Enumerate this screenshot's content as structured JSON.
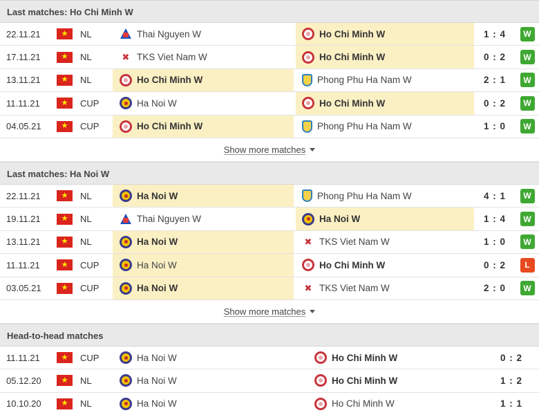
{
  "sections": [
    {
      "title": "Last matches: Ho Chi Minh W",
      "rows": [
        {
          "date": "22.11.21",
          "comp": "NL",
          "home": "Thai Nguyen W",
          "home_logo": "tn",
          "home_bold": false,
          "home_hl": false,
          "away": "Ho Chi Minh W",
          "away_logo": "hcm",
          "away_bold": true,
          "away_hl": true,
          "score": "1 : 4",
          "result": "W"
        },
        {
          "date": "17.11.21",
          "comp": "NL",
          "home": "TKS Viet Nam W",
          "home_logo": "tks",
          "home_bold": false,
          "home_hl": false,
          "away": "Ho Chi Minh W",
          "away_logo": "hcm",
          "away_bold": true,
          "away_hl": true,
          "score": "0 : 2",
          "result": "W"
        },
        {
          "date": "13.11.21",
          "comp": "NL",
          "home": "Ho Chi Minh W",
          "home_logo": "hcm",
          "home_bold": true,
          "home_hl": true,
          "away": "Phong Phu Ha Nam W",
          "away_logo": "pp",
          "away_bold": false,
          "away_hl": false,
          "score": "2 : 1",
          "result": "W"
        },
        {
          "date": "11.11.21",
          "comp": "CUP",
          "home": "Ha Noi W",
          "home_logo": "hanoi",
          "home_bold": false,
          "home_hl": false,
          "away": "Ho Chi Minh W",
          "away_logo": "hcm",
          "away_bold": true,
          "away_hl": true,
          "score": "0 : 2",
          "result": "W"
        },
        {
          "date": "04.05.21",
          "comp": "CUP",
          "home": "Ho Chi Minh W",
          "home_logo": "hcm",
          "home_bold": true,
          "home_hl": true,
          "away": "Phong Phu Ha Nam W",
          "away_logo": "pp",
          "away_bold": false,
          "away_hl": false,
          "score": "1 : 0",
          "result": "W"
        }
      ],
      "more_label": "Show more matches"
    },
    {
      "title": "Last matches: Ha Noi W",
      "rows": [
        {
          "date": "22.11.21",
          "comp": "NL",
          "home": "Ha Noi W",
          "home_logo": "hanoi",
          "home_bold": true,
          "home_hl": true,
          "away": "Phong Phu Ha Nam W",
          "away_logo": "pp",
          "away_bold": false,
          "away_hl": false,
          "score": "4 : 1",
          "result": "W"
        },
        {
          "date": "19.11.21",
          "comp": "NL",
          "home": "Thai Nguyen W",
          "home_logo": "tn",
          "home_bold": false,
          "home_hl": false,
          "away": "Ha Noi W",
          "away_logo": "hanoi",
          "away_bold": true,
          "away_hl": true,
          "score": "1 : 4",
          "result": "W"
        },
        {
          "date": "13.11.21",
          "comp": "NL",
          "home": "Ha Noi W",
          "home_logo": "hanoi",
          "home_bold": true,
          "home_hl": true,
          "away": "TKS Viet Nam W",
          "away_logo": "tks",
          "away_bold": false,
          "away_hl": false,
          "score": "1 : 0",
          "result": "W"
        },
        {
          "date": "11.11.21",
          "comp": "CUP",
          "home": "Ha Noi W",
          "home_logo": "hanoi",
          "home_bold": false,
          "home_hl": true,
          "away": "Ho Chi Minh W",
          "away_logo": "hcm",
          "away_bold": true,
          "away_hl": false,
          "score": "0 : 2",
          "result": "L"
        },
        {
          "date": "03.05.21",
          "comp": "CUP",
          "home": "Ha Noi W",
          "home_logo": "hanoi",
          "home_bold": true,
          "home_hl": true,
          "away": "TKS Viet Nam W",
          "away_logo": "tks",
          "away_bold": false,
          "away_hl": false,
          "score": "2 : 0",
          "result": "W"
        }
      ],
      "more_label": "Show more matches"
    }
  ],
  "h2h": {
    "title": "Head-to-head matches",
    "rows": [
      {
        "date": "11.11.21",
        "comp": "CUP",
        "home": "Ha Noi W",
        "home_logo": "hanoi",
        "home_bold": false,
        "away": "Ho Chi Minh W",
        "away_logo": "hcm",
        "away_bold": true,
        "score": "0 : 2"
      },
      {
        "date": "05.12.20",
        "comp": "NL",
        "home": "Ha Noi W",
        "home_logo": "hanoi",
        "home_bold": false,
        "away": "Ho Chi Minh W",
        "away_logo": "hcm",
        "away_bold": true,
        "score": "1 : 2"
      },
      {
        "date": "10.10.20",
        "comp": "NL",
        "home": "Ha Noi W",
        "home_logo": "hanoi",
        "home_bold": false,
        "away": "Ho Chi Minh W",
        "away_logo": "hcm",
        "away_bold": false,
        "score": "1 : 1"
      }
    ]
  },
  "flag_icon": "vietnam-flag-icon",
  "colors": {
    "win": "#3fa832",
    "loss": "#e84a1f",
    "highlight": "#fbf0c4",
    "header_bg": "#e9e9e9"
  }
}
